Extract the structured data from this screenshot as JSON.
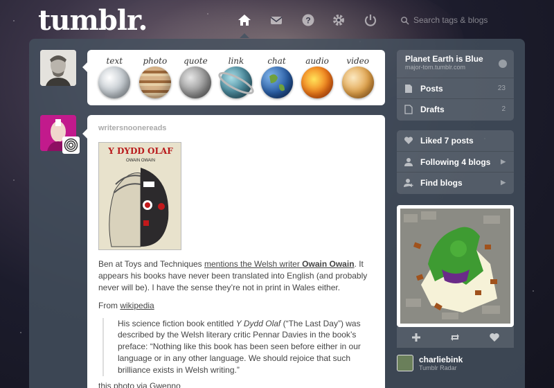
{
  "header": {
    "logo": "tumblr.",
    "search_placeholder": "Search tags & blogs",
    "nav": [
      "home-icon",
      "inbox-icon",
      "help-icon",
      "settings-icon",
      "power-icon"
    ]
  },
  "post_types": [
    {
      "label": "text",
      "color": "#c9cfd4"
    },
    {
      "label": "photo",
      "color": "#b77a3e"
    },
    {
      "label": "quote",
      "color": "#8b8d8f"
    },
    {
      "label": "link",
      "color": "#4c8a9c"
    },
    {
      "label": "chat",
      "color": "#2a5fa7"
    },
    {
      "label": "audio",
      "color": "#f07a1a"
    },
    {
      "label": "video",
      "color": "#e1a24a"
    }
  ],
  "post": {
    "author": "writersnoonereads",
    "photo_title": "Y DYDD OLAF",
    "photo_author": "OWAIN OWAIN",
    "p1_a": "Ben at Toys and Techniques ",
    "p1_link1": "mentions the Welsh writer ",
    "p1_link1_bold": "Owain Owain",
    "p1_b": ". It appears his books have never been translated into English (and probably never will be). I have the sense they’re not in print in Wales either.",
    "from_label": "From ",
    "from_link": "wikipedia",
    "quote_a": "His science fiction book entitled ",
    "quote_em": "Y Dydd Olaf",
    "quote_b": " (“The Last Day”) was described by the Welsh literary critic Pennar Davies in the book’s preface: “Nothing like this book has been seen before either in our language or in any other language. We should rejoice that such brilliance exists in Welsh writing.”",
    "via_label": "this photo via ",
    "via_link": "Gwenno"
  },
  "sidebar": {
    "blog_title": "Planet Earth is Blue",
    "blog_url": "major-tom.tumblr.com",
    "posts_label": "Posts",
    "posts_count": "23",
    "drafts_label": "Drafts",
    "drafts_count": "2",
    "liked_label": "Liked 7 posts",
    "following_label": "Following 4 blogs",
    "find_label": "Find blogs"
  },
  "radar": {
    "user": "charliebink",
    "source": "Tumblr Radar"
  }
}
